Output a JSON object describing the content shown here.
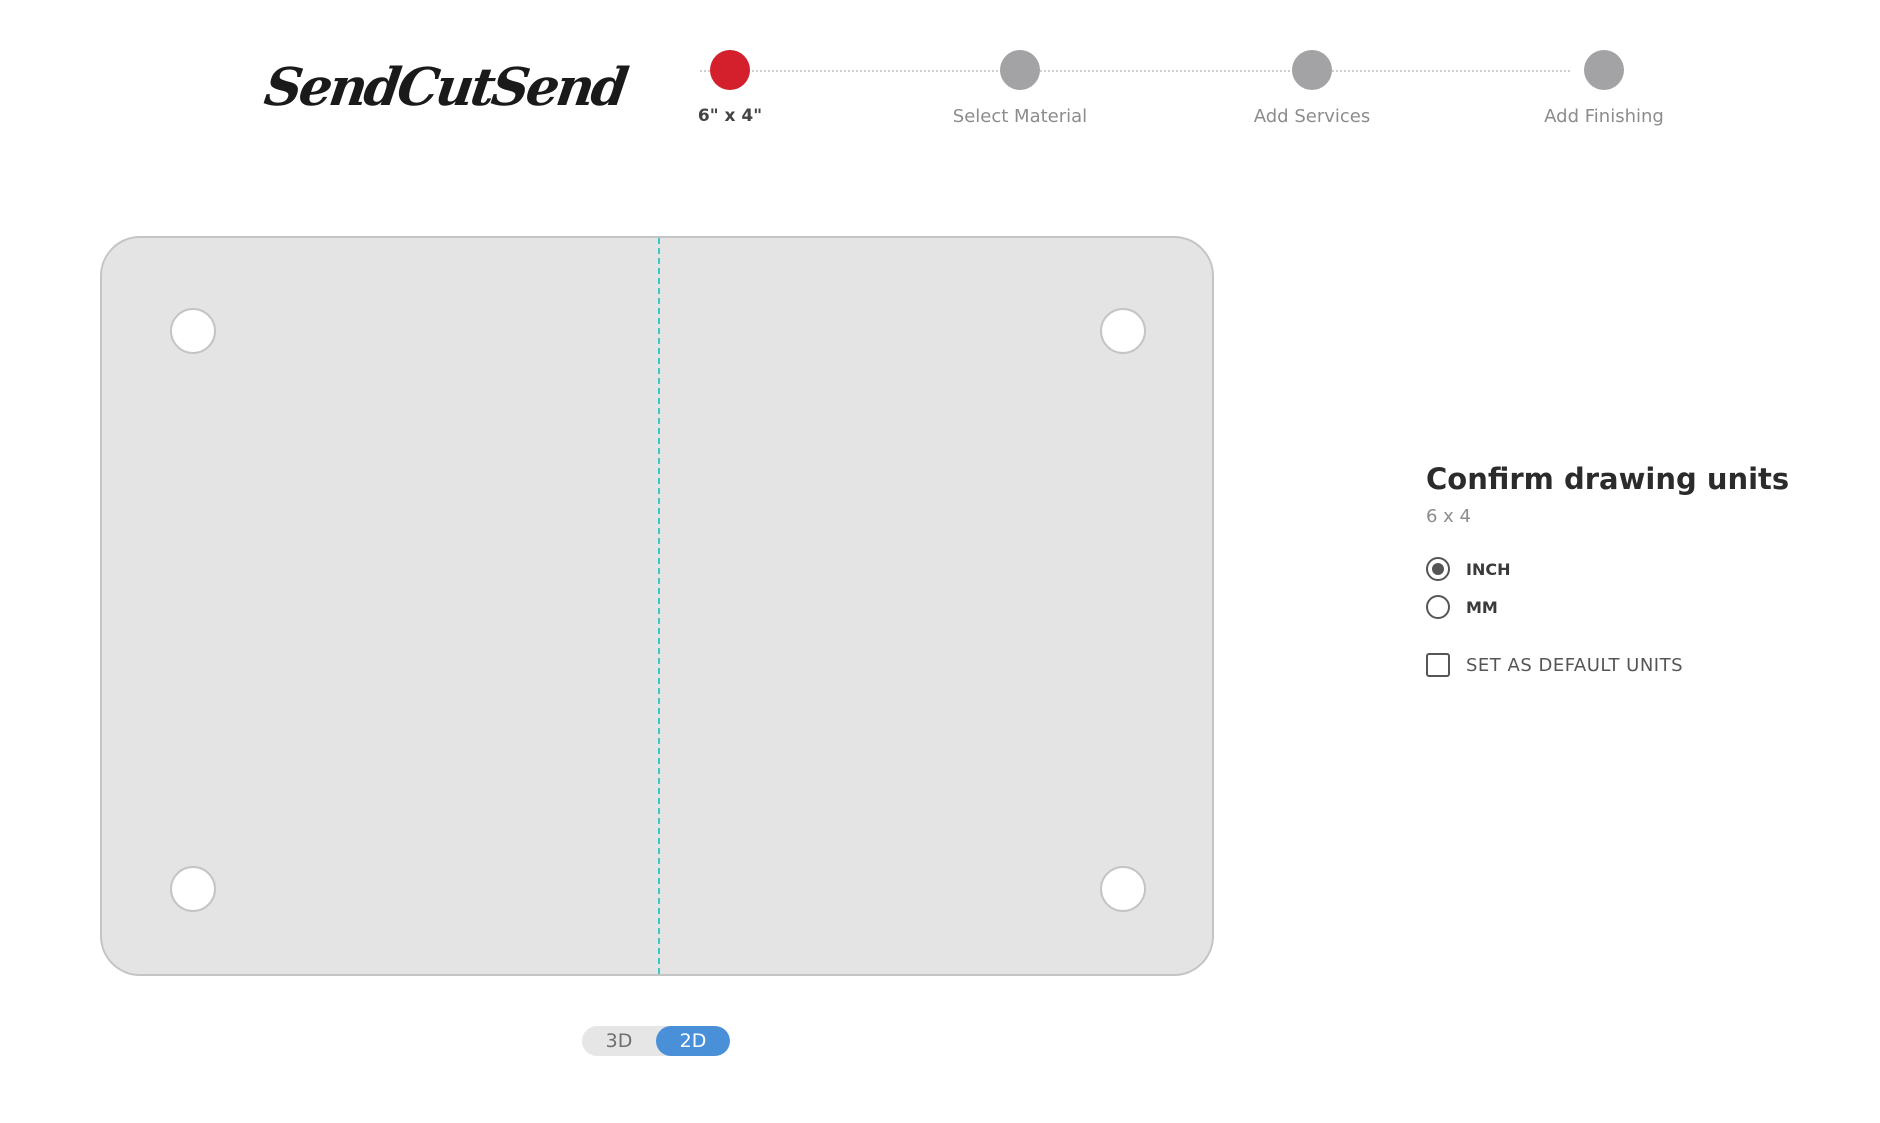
{
  "brand": {
    "logo_text": "SendCutSend"
  },
  "stepper": {
    "steps": [
      {
        "label": "6\" x 4\"",
        "active": true
      },
      {
        "label": "Select Material",
        "active": false
      },
      {
        "label": "Add Services",
        "active": false
      },
      {
        "label": "Add Finishing",
        "active": false
      }
    ]
  },
  "view_toggle": {
    "options": [
      "3D",
      "2D"
    ],
    "selected": "2D"
  },
  "units_panel": {
    "title": "Confirm drawing units",
    "dimensions": "6 x 4",
    "options": [
      "INCH",
      "MM"
    ],
    "selected": "INCH",
    "default_label": "SET AS DEFAULT UNITS",
    "default_checked": false
  },
  "colors": {
    "active_step": "#d3202c",
    "inactive_step": "#a3a3a6",
    "toggle_active": "#4a90d9",
    "centerline": "#3ec7c7",
    "part_fill": "#e4e4e4"
  }
}
